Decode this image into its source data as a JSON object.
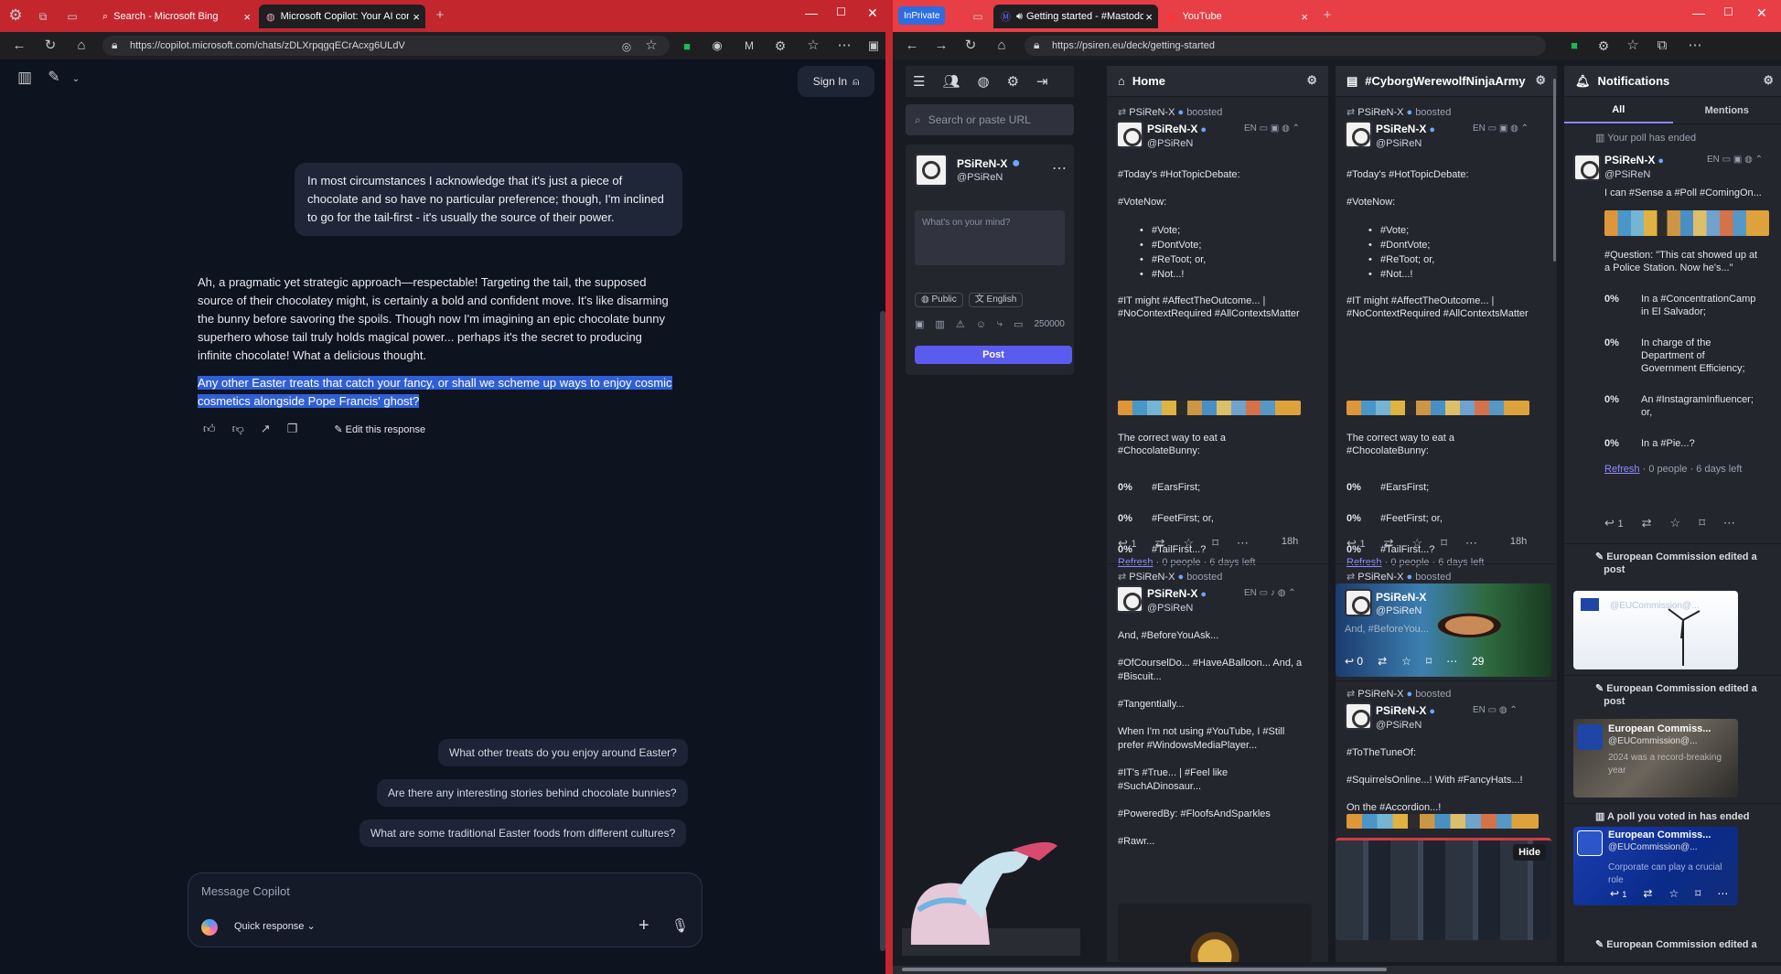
{
  "left_browser": {
    "tabs": [
      {
        "label": "Search - Microsoft Bing"
      },
      {
        "label": "Microsoft Copilot: Your AI compa..."
      }
    ],
    "url": "https://copilot.microsoft.com/chats/zDLXrpqgqECrAcxg6ULdV",
    "sign_in": "Sign In",
    "user_message": "In most circumstances I acknowledge that it's just a piece of chocolate and so have no particular preference; though, I'm inclined to go for the tail-first - it's usually the source of their power.",
    "response_lines": [
      "Ah, a pragmatic yet strategic approach—respectable! Targeting the tail, the supposed",
      "source of their chocolatey might, is certainly a bold and confident move. It's like disarming",
      "the bunny before savoring the spoils. Though now I'm imagining an epic chocolate bunny",
      "superhero whose tail truly holds magical power... perhaps it's the secret to producing",
      "infinite chocolate! What a delicious thought."
    ],
    "highlight_lines": [
      "Any other Easter treats that catch your fancy, or shall we scheme up ways to enjoy cosmic",
      "cosmetics alongside Pope Francis' ghost?"
    ],
    "edit_response": "Edit this response",
    "suggestions": [
      "What other treats do you enjoy around Easter?",
      "Are there any interesting stories behind chocolate bunnies?",
      "What are some traditional Easter foods from different cultures?"
    ],
    "message_placeholder": "Message Copilot",
    "quick_response": "Quick response"
  },
  "right_browser": {
    "inprivate": "InPrivate",
    "tabs": [
      {
        "label": "Getting started - #Mastodon"
      },
      {
        "label": "YouTube"
      }
    ],
    "url": "https://psiren.eu/deck/getting-started",
    "sidebar": {
      "search_placeholder": "Search or paste URL",
      "name": "PSiReN-X",
      "handle": "@PSiReN",
      "compose_placeholder": "What's on your mind?",
      "visibility": "Public",
      "language": "English",
      "char_count": "250000",
      "post_button": "Post"
    },
    "home_column": {
      "title": "Home"
    },
    "hashtag_column": {
      "title": "#CyborgWerewolfNinjaArmy"
    },
    "notifications_column": {
      "title": "Notifications",
      "tabs": [
        "All",
        "Mentions"
      ]
    },
    "post1": {
      "boost_label": "PSiReN-X",
      "boosted": "boosted",
      "name": "PSiReN-X",
      "handle": "@PSiReN",
      "lang": "EN",
      "lines": [
        "#Today's #HotTopicDebate:",
        "#VoteNow:"
      ],
      "bullets": [
        "#Vote;",
        "#DontVote;",
        "#ReToot; or,",
        "#Not...!"
      ],
      "line2a": "#IT might #AffectTheOutcome... |",
      "line2b": "#NoContextRequired #AllContextsMatter",
      "q1": "The correct way to eat a",
      "q2": "#ChocolateBunny:",
      "poll": [
        {
          "pct": "0%",
          "label": "#EarsFirst;"
        },
        {
          "pct": "0%",
          "label": "#FeetFirst; or,"
        },
        {
          "pct": "0%",
          "label": "#TailFirst...?"
        }
      ],
      "refresh": "Refresh",
      "poll_meta": "· 0 people · 6 days left",
      "reply_count": "1",
      "time": "18h"
    },
    "post2": {
      "boost_label": "PSiReN-X",
      "boosted": "boosted",
      "name": "PSiReN-X",
      "handle": "@PSiReN",
      "lang": "EN",
      "lines": [
        "And, #BeforeYouAsk...",
        "#OfCourselDo... #HaveABalloon... And, a",
        "#Biscuit...",
        "#Tangentially...",
        "When I'm not using #YouTube, I #Still",
        "prefer #WindowsMediaPlayer...",
        "#IT's #True... | #Feel like",
        "#SuchADinosaur...",
        "#PoweredBy: #FloofsAndSparkles",
        "#Rawr..."
      ]
    },
    "post3": {
      "boost_label": "PSiReN-X",
      "boosted": "boosted",
      "name": "PSiReN-X",
      "handle": "@PSiReN",
      "overlay": "And, #BeforeYou...",
      "reply_count": "0",
      "count": "29"
    },
    "post4": {
      "boost_label": "PSiReN-X",
      "boosted": "boosted",
      "name": "PSiReN-X",
      "handle": "@PSiReN",
      "lang": "EN",
      "lines": [
        "#ToTheTuneOf:",
        "#SquirrelsOnline...! With #FancyHats...!",
        "On the #Accordion...!"
      ],
      "hide": "Hide"
    },
    "notifications": {
      "poll_ended": "Your poll has ended",
      "name": "PSiReN-X",
      "handle": "@PSiReN",
      "lang": "EN",
      "text": "I can #Sense a #Poll #ComingOn...",
      "question_a": "#Question: \"This cat showed up at",
      "question_b": "a Police Station. Now he's...\"",
      "poll": [
        {
          "pct": "0%",
          "lines": [
            "In a #ConcentrationCamp",
            "in El Salvador;"
          ]
        },
        {
          "pct": "0%",
          "lines": [
            "In charge of the",
            "Department of",
            "Government Efficiency;"
          ]
        },
        {
          "pct": "0%",
          "lines": [
            "An #InstagramInfluencer;",
            "or,"
          ]
        },
        {
          "pct": "0%",
          "lines": [
            "In a #Pie...?"
          ]
        }
      ],
      "refresh": "Refresh",
      "poll_meta": "· 0 people · 6 days left",
      "reply_count": "1",
      "edited1": "European Commission edited a",
      "edited1b": "post",
      "card1_handle": "@EUCommission@...",
      "edited2": "European Commission edited a",
      "edited2b": "post",
      "card2_name": "European Commiss...",
      "card2_handle": "@EUCommission@...",
      "card2_text": "2024 was a record-breaking year",
      "poll_voted": "A poll you voted in has ended",
      "card3_name": "European Commiss...",
      "card3_handle": "@EUCommission@...",
      "card3_text": "Corporate can play a crucial role",
      "card3_count": "1",
      "edited3": "European Commission edited a"
    }
  }
}
